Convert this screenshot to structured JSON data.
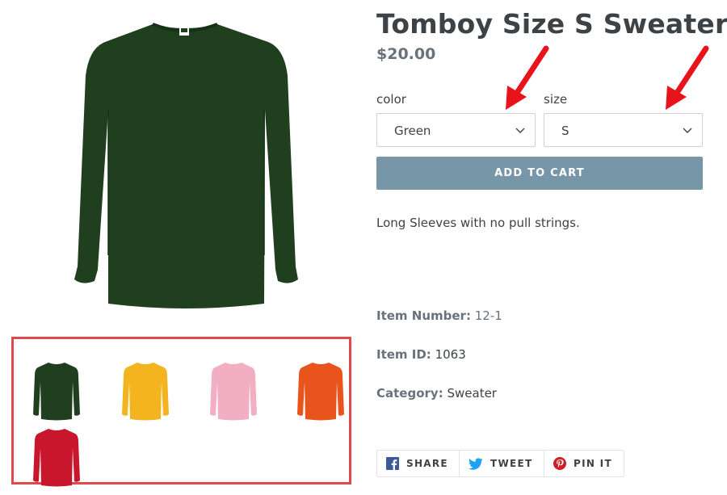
{
  "product": {
    "title": "Tomboy Size S Sweater",
    "price": "$20.00",
    "description": "Long Sleeves with no pull strings."
  },
  "options": {
    "color": {
      "label": "color",
      "value": "Green"
    },
    "size": {
      "label": "size",
      "value": "S"
    }
  },
  "add_to_cart_label": "ADD TO CART",
  "meta": {
    "item_number": {
      "label": "Item Number:",
      "value": "12-1"
    },
    "item_id": {
      "label": "Item ID:",
      "value": "1063"
    },
    "category": {
      "label": "Category:",
      "value": "Sweater"
    }
  },
  "share": {
    "facebook": "SHARE",
    "twitter": "TWEET",
    "pinterest": "PIN IT"
  },
  "thumbnails": [
    {
      "color": "#1f3f1f"
    },
    {
      "color": "#f4b420"
    },
    {
      "color": "#f2aec2"
    },
    {
      "color": "#e8541c"
    },
    {
      "color": "#c8172c"
    }
  ],
  "colors": {
    "main_sweater": "#1f3f1f",
    "button": "#7796a8",
    "highlight_border": "#e0484c",
    "annotation_arrow": "#e8141c"
  }
}
